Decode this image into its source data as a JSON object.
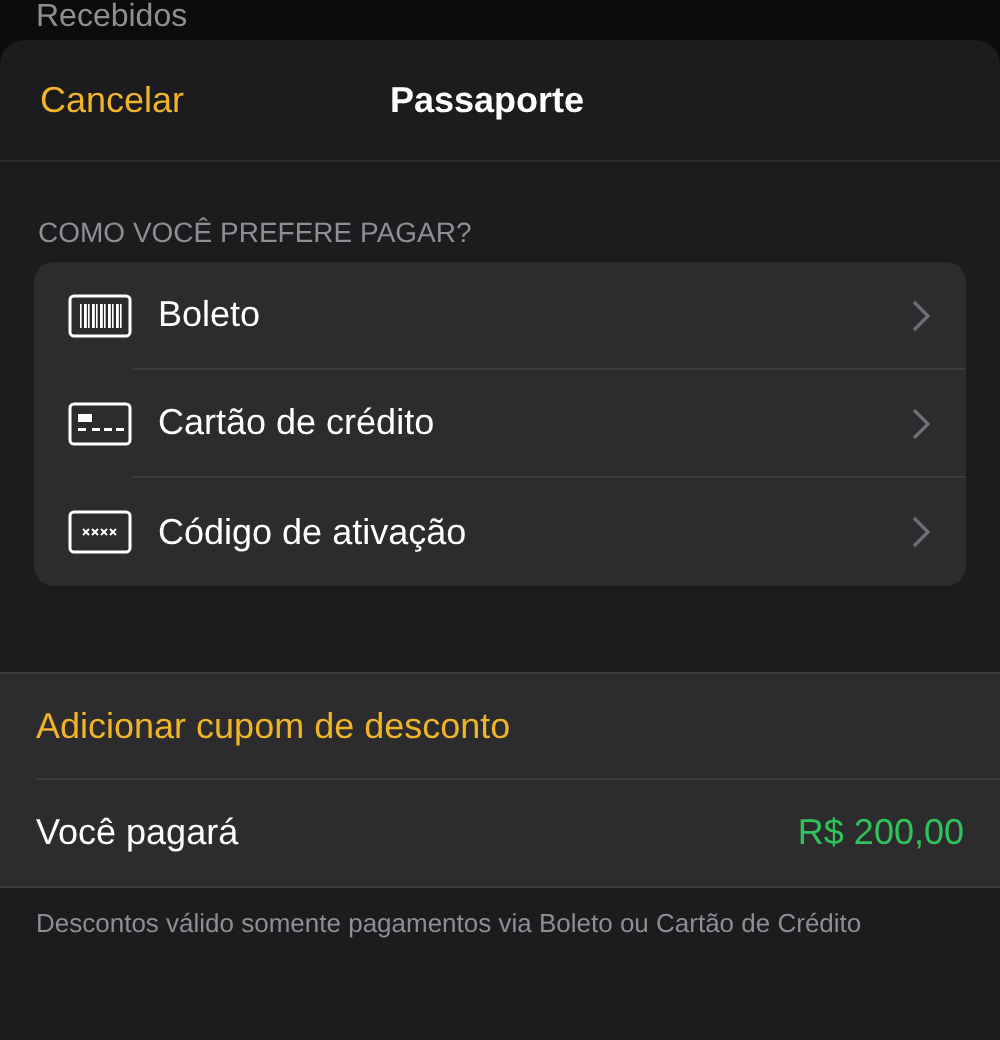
{
  "background_row": {
    "label": "Recebidos"
  },
  "header": {
    "cancel": "Cancelar",
    "title": "Passaporte"
  },
  "payment_section": {
    "heading": "COMO VOCÊ PREFERE PAGAR?",
    "methods": [
      {
        "kind": "barcode",
        "label": "Boleto"
      },
      {
        "kind": "card",
        "label": "Cartão de crédito"
      },
      {
        "kind": "code",
        "label": "Código de ativação"
      }
    ]
  },
  "coupon": {
    "label": "Adicionar cupom de desconto"
  },
  "total": {
    "label": "Você pagará",
    "amount": "R$ 200,00"
  },
  "footnote": "Descontos válido somente pagamentos via Boleto ou Cartão de Crédito"
}
